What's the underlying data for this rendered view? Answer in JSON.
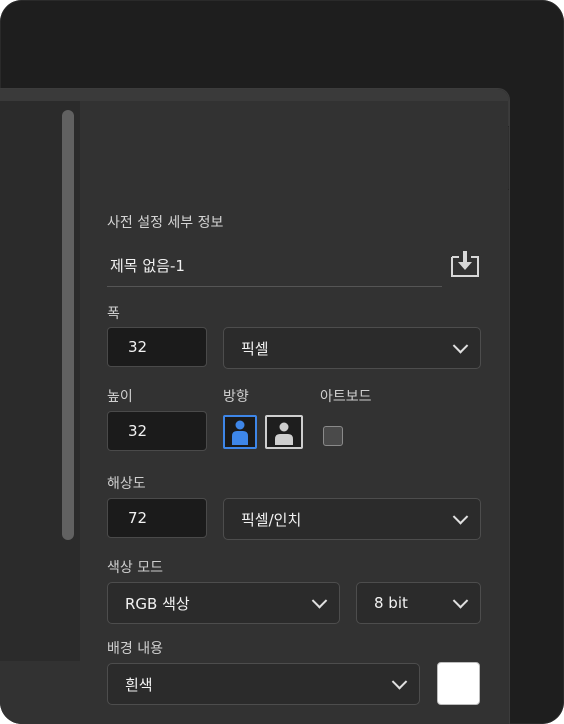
{
  "panel": {
    "section_title": "사전 설정 세부 정보",
    "preset_name": "제목 없음-1",
    "icons": {
      "save_preset": "save-preset-icon",
      "chevron": "chevron-down-icon"
    },
    "width": {
      "label": "폭",
      "value": "32",
      "unit": "픽셀"
    },
    "height": {
      "label": "높이",
      "value": "32"
    },
    "orientation": {
      "label": "방향",
      "selected": "portrait"
    },
    "artboard": {
      "label": "아트보드",
      "checked": false
    },
    "resolution": {
      "label": "해상도",
      "value": "72",
      "unit": "픽셀/인치"
    },
    "color_mode": {
      "label": "색상 모드",
      "mode": "RGB 색상",
      "depth": "8 bit"
    },
    "background": {
      "label": "배경 내용",
      "value": "흰색",
      "swatch_color": "#ffffff"
    }
  },
  "colors": {
    "accent": "#3e86e8",
    "panel_bg": "#323232",
    "field_bg": "#1b1b1b"
  }
}
